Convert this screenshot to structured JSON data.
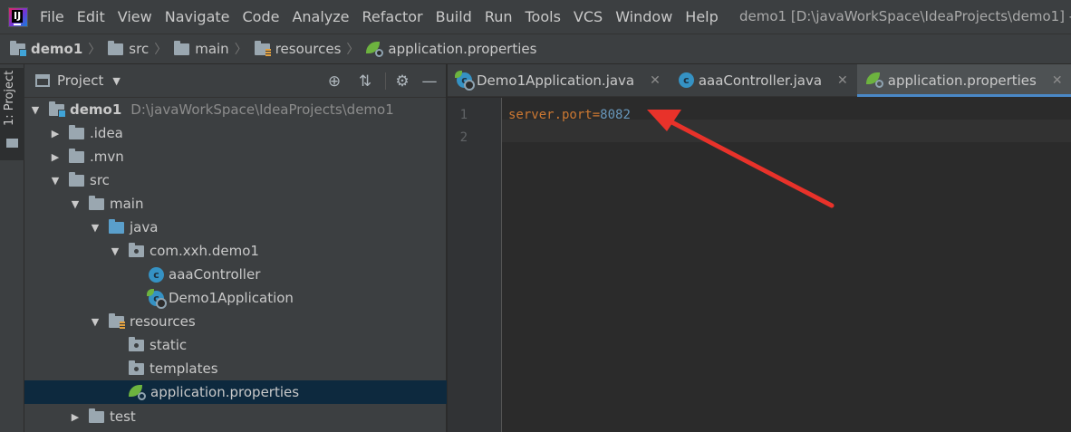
{
  "menubar": {
    "items": [
      "File",
      "Edit",
      "View",
      "Navigate",
      "Code",
      "Analyze",
      "Refactor",
      "Build",
      "Run",
      "Tools",
      "VCS",
      "Window",
      "Help"
    ],
    "window_title": "demo1 [D:\\javaWorkSpace\\IdeaProjects\\demo1] -"
  },
  "breadcrumb": [
    "demo1",
    "src",
    "main",
    "resources",
    "application.properties"
  ],
  "toolstrip": {
    "project_tab": "1: Project"
  },
  "project_panel": {
    "title": "Project",
    "header_icons": [
      "locate-icon",
      "collapse-all-icon",
      "gear-icon",
      "minimize-icon"
    ],
    "tree": [
      {
        "label": "demo1",
        "path": "D:\\javaWorkSpace\\IdeaProjects\\demo1",
        "expanded": true,
        "icon": "module-folder-icon"
      },
      {
        "label": ".idea",
        "expanded": false,
        "icon": "folder-icon"
      },
      {
        "label": ".mvn",
        "expanded": false,
        "icon": "folder-icon"
      },
      {
        "label": "src",
        "expanded": true,
        "icon": "folder-icon"
      },
      {
        "label": "main",
        "expanded": true,
        "icon": "folder-icon"
      },
      {
        "label": "java",
        "expanded": true,
        "icon": "source-folder-icon"
      },
      {
        "label": "com.xxh.demo1",
        "expanded": true,
        "icon": "package-icon"
      },
      {
        "label": "aaaController",
        "icon": "java-class-icon"
      },
      {
        "label": "Demo1Application",
        "icon": "spring-boot-class-icon"
      },
      {
        "label": "resources",
        "expanded": true,
        "icon": "resources-folder-icon"
      },
      {
        "label": "static",
        "icon": "package-folder-icon"
      },
      {
        "label": "templates",
        "icon": "package-folder-icon"
      },
      {
        "label": "application.properties",
        "icon": "spring-properties-icon",
        "selected": true
      },
      {
        "label": "test",
        "expanded": false,
        "icon": "folder-icon"
      }
    ]
  },
  "editor": {
    "tabs": [
      {
        "label": "Demo1Application.java",
        "icon": "spring-boot-class-icon",
        "active": false
      },
      {
        "label": "aaaController.java",
        "icon": "java-class-icon",
        "active": false
      },
      {
        "label": "application.properties",
        "icon": "spring-properties-icon",
        "active": true
      }
    ],
    "line_numbers": [
      "1",
      "2"
    ],
    "code": {
      "key": "server.port",
      "eq": "=",
      "value": "8082"
    },
    "annotation": {
      "type": "red-arrow",
      "color": "#e8322a"
    }
  },
  "colors": {
    "background": "#2b2b2b",
    "panel": "#3c3f41",
    "selection": "#0d293e",
    "accent": "#4a88c7",
    "keyword": "#cc7832",
    "number": "#6897bb",
    "annotation": "#e8322a"
  }
}
